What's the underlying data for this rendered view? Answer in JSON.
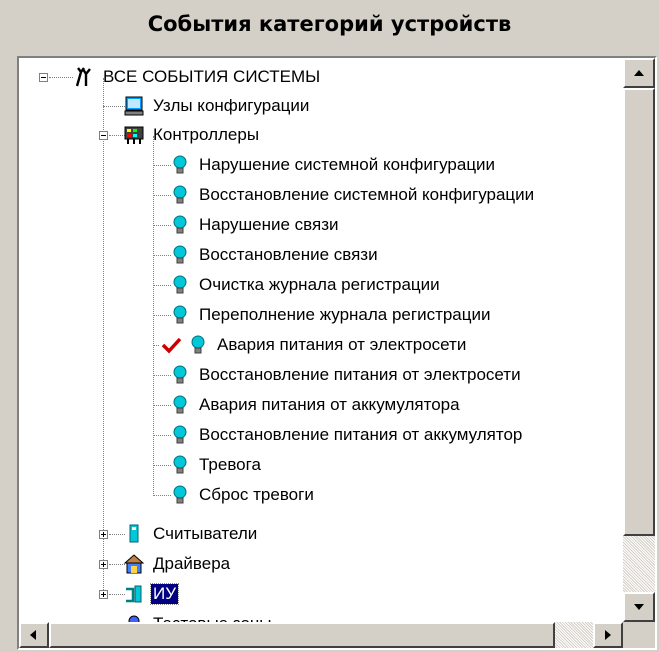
{
  "title": "События категорий устройств",
  "tree": {
    "root": "ВСЕ СОБЫТИЯ СИСТЕМЫ",
    "nodes": [
      "Узлы конфигурации",
      "Контроллеры",
      "Нарушение системной конфигурации",
      "Восстановление системной конфигурации",
      "Нарушение связи",
      "Восстановление связи",
      "Очистка журнала регистрации",
      "Переполнение журнала регистрации",
      "Авария питания от электросети",
      "Восстановление питания от электросети",
      "Авария питания от аккумулятора",
      "Восстановление питания от аккумулятор",
      "Тревога",
      "Сброс тревоги",
      "Считыватели",
      "Драйвера",
      "ИУ",
      "Тестовые зоны"
    ]
  },
  "colors": {
    "selection": "#000080",
    "check": "#cc0000",
    "bulb": "#00c8d8",
    "panel_bg": "#d4d0c8"
  },
  "icons": [
    "all-events-icon",
    "computer-icon",
    "controller-icon",
    "bulb-icon",
    "checkmark-icon",
    "reader-icon",
    "driver-icon",
    "actuator-icon",
    "zone-icon"
  ]
}
